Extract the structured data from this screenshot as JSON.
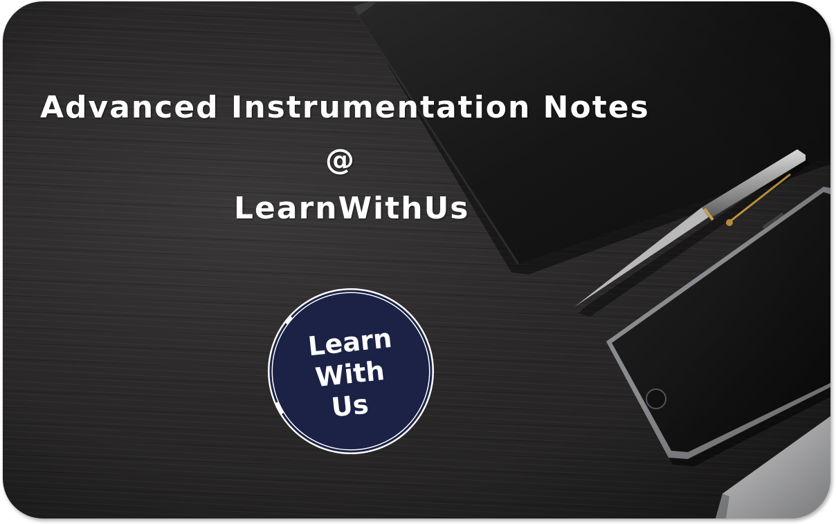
{
  "heading": {
    "line1": "Advanced Instrumentation Notes",
    "line2": "@",
    "line3": "LearnWithUs"
  },
  "logo": {
    "line1": "Learn",
    "line2": "With",
    "line3": "Us",
    "background": "#1b2246",
    "ring": "#ffffff"
  },
  "colors": {
    "desk": "#2a2828",
    "notebook": "#141414",
    "text": "#ffffff"
  },
  "icons": {
    "notebook": "notebook-icon",
    "pen": "pen-icon",
    "phone": "smartphone-icon",
    "laptop": "laptop-corner-icon"
  }
}
